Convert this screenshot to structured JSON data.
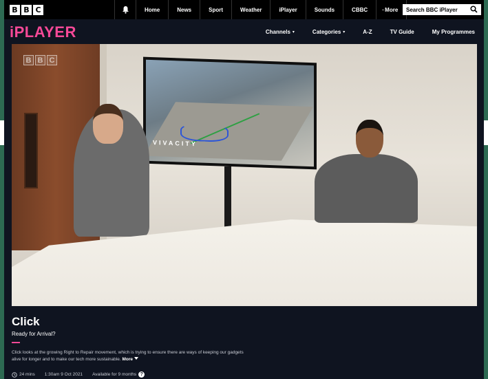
{
  "topnav": {
    "logo_letters": [
      "B",
      "B",
      "C"
    ],
    "links": [
      "Home",
      "News",
      "Sport",
      "Weather",
      "iPlayer",
      "Sounds",
      "CBBC",
      "More"
    ],
    "dash": "-",
    "search_placeholder": "Search BBC iPlayer",
    "icons": [
      "bell-icon",
      "search-icon"
    ]
  },
  "iplayer": {
    "logo": "iPLAYER",
    "nav": [
      {
        "label": "Channels",
        "has_caret": true
      },
      {
        "label": "Categories",
        "has_caret": true
      },
      {
        "label": "A-Z",
        "has_caret": false
      },
      {
        "label": "TV Guide",
        "has_caret": false
      },
      {
        "label": "My Programmes",
        "has_caret": false
      }
    ],
    "caret": "▾"
  },
  "video": {
    "watermark_letters": [
      "B",
      "B",
      "C"
    ],
    "tv_label": "VIVACITY"
  },
  "programme": {
    "title": "Click",
    "subtitle": "Ready for Arrival?",
    "description": "Click looks at the growing Right to Repair movement, which is trying to ensure there are ways of keeping our gadgets alive for longer and to make our tech more sustainable.",
    "more_label": "More",
    "duration": "24 mins",
    "broadcast": "1:30am 9 Oct 2021",
    "availability": "Available for 9 months",
    "info_glyph": "?"
  },
  "colors": {
    "accent": "#f54997",
    "background": "#0f1420",
    "border_green": "#2d6a52"
  }
}
